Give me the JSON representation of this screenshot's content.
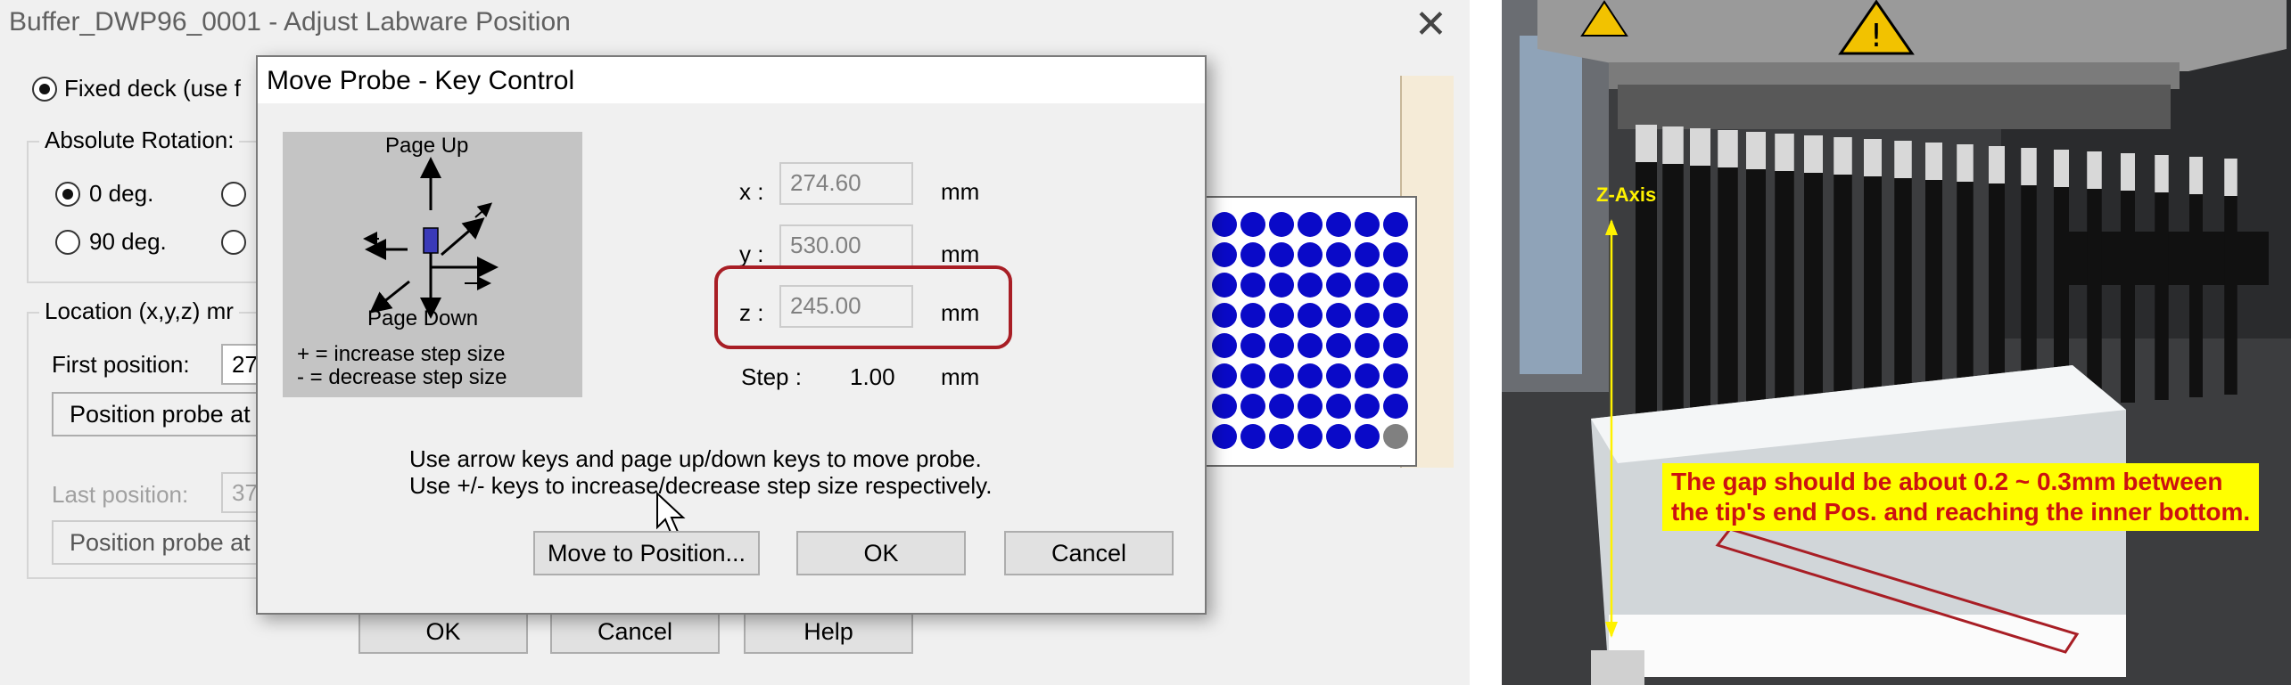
{
  "background_dialog": {
    "title": "Buffer_DWP96_0001 - Adjust Labware Position",
    "close_glyph": "✕",
    "fixed_deck_label": "Fixed deck (use f",
    "rotation_group_label": "Absolute Rotation:",
    "rotation_options": [
      "0 deg.",
      "90 deg."
    ],
    "location_group_label": "Location (x,y,z) mr",
    "first_position_label": "First position:",
    "first_position_value": "27",
    "position_probe_label_1": "Position probe at",
    "last_position_label": "Last position:",
    "last_position_value": "37",
    "position_probe_label_2": "Position probe at",
    "ok_label": "OK",
    "cancel_label": "Cancel",
    "help_label": "Help"
  },
  "move_probe_dialog": {
    "title": "Move Probe - Key Control",
    "page_up_label": "Page Up",
    "page_down_label": "Page Down",
    "increase_hint": "+ = increase step size",
    "decrease_hint": "- = decrease step size",
    "x_label": "x :",
    "x_value": "274.60",
    "y_label": "y :",
    "y_value": "530.00",
    "z_label": "z :",
    "z_value": "245.00",
    "unit": "mm",
    "step_label": "Step :",
    "step_value": "1.00",
    "instructions_line1": "Use arrow keys and page up/down keys to move probe.",
    "instructions_line2": "Use +/- keys to increase/decrease step size respectively.",
    "move_to_position_label": "Move to Position...",
    "ok_label": "OK",
    "cancel_label": "Cancel"
  },
  "plate_preview": {
    "well_color": "#0a0ac8",
    "empty_well_color": "#808080"
  },
  "photo": {
    "z_axis_label": "Z-Axis",
    "gap_note_line1": "The gap should be about 0.2 ~ 0.3mm between",
    "gap_note_line2": "the tip's end Pos. and reaching the inner bottom.",
    "annotation_color": "#cc1111",
    "arrow_color": "#fff200"
  }
}
